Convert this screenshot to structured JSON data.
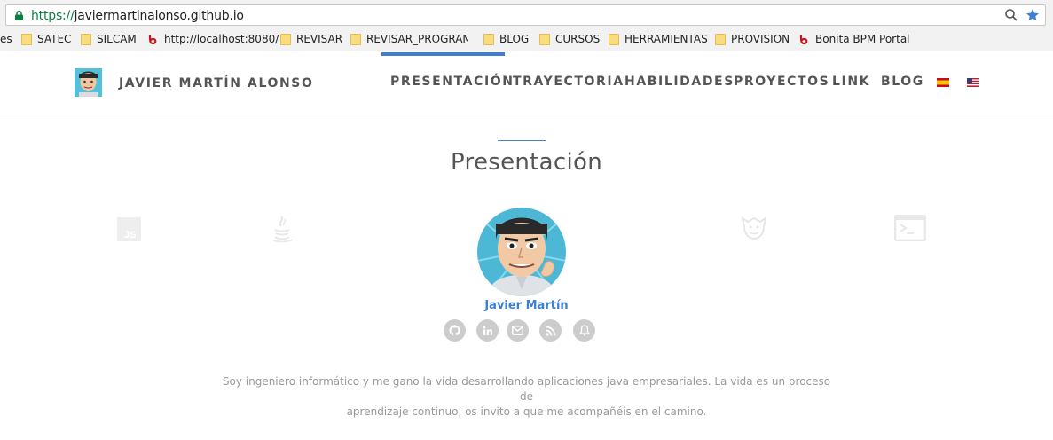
{
  "browser": {
    "url_scheme": "https://",
    "url_rest": "javiermartinalonso.github.io",
    "bookmarks": [
      {
        "label": "es",
        "type": "partial"
      },
      {
        "label": "SATEC",
        "type": "folder"
      },
      {
        "label": "SILCAM",
        "type": "folder"
      },
      {
        "label": "http://localhost:8080/",
        "type": "bonita"
      },
      {
        "label": "REVISAR",
        "type": "folder"
      },
      {
        "label": "REVISAR_PROGRAMA",
        "type": "folder"
      },
      {
        "label": "BLOG",
        "type": "folder"
      },
      {
        "label": "CURSOS",
        "type": "folder"
      },
      {
        "label": "HERRAMIENTAS",
        "type": "folder"
      },
      {
        "label": "PROVISION",
        "type": "folder"
      },
      {
        "label": "Bonita BPM Portal",
        "type": "bonita"
      }
    ]
  },
  "header": {
    "brand_name": "JAVIER MARTÍN ALONSO",
    "nav": [
      "PRESENTACIÓN",
      "TRAYECTORIA",
      "HABILIDADES",
      "PROYECTOS",
      "LINK",
      "BLOG"
    ],
    "active_nav": "PRESENTACIÓN",
    "accent_color": "#3c7fd3"
  },
  "main": {
    "title": "Presentación",
    "tech_icons": [
      "javascript-icon",
      "java-icon",
      "jenkins-icon",
      "terminal-icon"
    ],
    "profile_name": "Javier Martín",
    "social_icons": [
      "github-icon",
      "linkedin-icon",
      "email-icon",
      "rss-icon",
      "bell-icon"
    ],
    "intro_line1": "Soy ingeniero informático y me gano la vida desarrollando aplicaciones java empresariales. La vida es un proceso de",
    "intro_line2": "aprendizaje continuo, os invito a que me acompañéis en el camino."
  }
}
